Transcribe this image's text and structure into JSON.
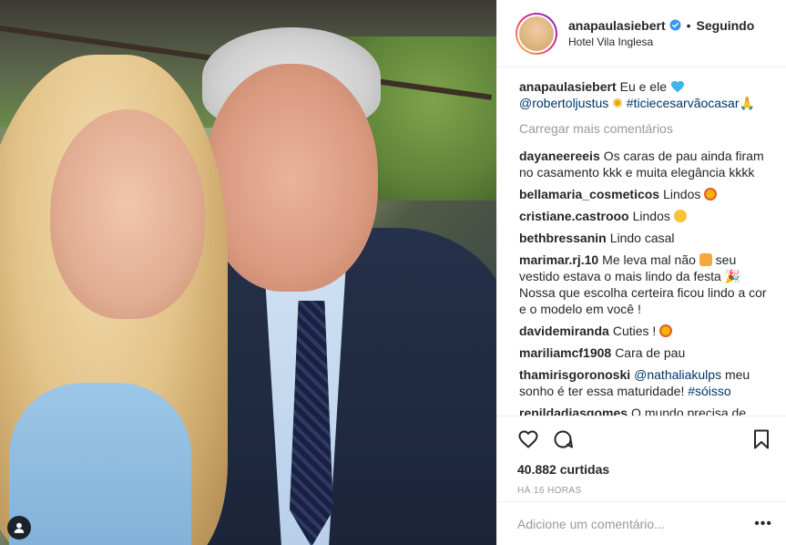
{
  "post": {
    "author": "anapaulasiebert",
    "follow_status": "Seguindo",
    "separator": "•",
    "location": "Hotel Vila Inglesa",
    "caption_text": "Eu e ele",
    "caption_mention": "@robertoljustus",
    "caption_hashtag": "#ticiecesarvãocasar"
  },
  "load_more": "Carregar mais comentários",
  "comments": [
    {
      "user": "dayaneereeis",
      "text": "Os caras de pau ainda firam no casamento kkk e muita elegância kkkk"
    },
    {
      "user": "bellamaria_cosmeticos",
      "text": "Lindos"
    },
    {
      "user": "cristiane.castrooo",
      "text": "Lindos"
    },
    {
      "user": "bethbressanin",
      "text": "Lindo casal"
    },
    {
      "user": "marimar.rj.10",
      "text": "Me leva mal não",
      "text2": "seu vestido estava o mais lindo da festa",
      "text3": "Nossa que escolha certeira ficou lindo a cor e o modelo em você !"
    },
    {
      "user": "davidemiranda",
      "text": "Cuties !"
    },
    {
      "user": "mariliamcf1908",
      "text": "Cara de pau"
    },
    {
      "user": "thamirisgoronoski",
      "mention": "@nathaliakulps",
      "text": "meu sonho é ter essa maturidade!",
      "hashtag": "#sóisso"
    },
    {
      "user": "renildadiasgomes",
      "text": "O mundo precisa de"
    }
  ],
  "likes": "40.882 curtidas",
  "time_ago": "Há 16 horas",
  "add_comment_placeholder": "Adicione um comentário...",
  "more_options": "•••",
  "icons": {
    "like": "heart-icon",
    "comment": "comment-bubble-icon",
    "save": "bookmark-icon",
    "user_tag": "user-tag-icon",
    "verified": "verified-badge-icon"
  },
  "colors": {
    "link": "#003569",
    "verified": "#3897f0",
    "muted": "#999999",
    "text": "#262626"
  }
}
